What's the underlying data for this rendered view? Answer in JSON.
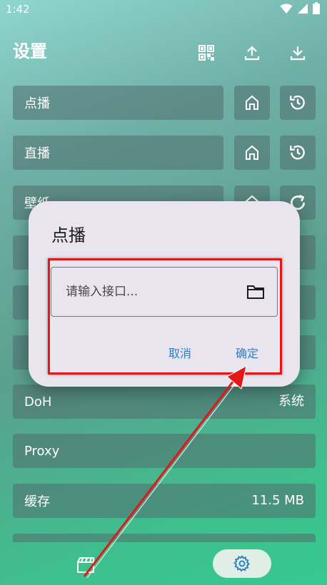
{
  "status_bar": {
    "time": "1:42"
  },
  "header": {
    "title": "设置"
  },
  "rows": [
    {
      "label": "点播"
    },
    {
      "label": "直播"
    },
    {
      "label": "壁纸"
    },
    {
      "label": ""
    },
    {
      "label": ""
    },
    {
      "label": ""
    },
    {
      "label": "DoH",
      "value": "系统"
    },
    {
      "label": "Proxy"
    },
    {
      "label": "缓存",
      "value": "11.5 MB"
    }
  ],
  "dialog": {
    "title": "点播",
    "input_placeholder": "请输入接口...",
    "input_value": "",
    "cancel_label": "取消",
    "confirm_label": "确定"
  },
  "icons": {
    "qr": "qr-code-icon",
    "upload": "upload-icon",
    "download": "download-icon",
    "home": "home-icon",
    "history": "history-icon",
    "refresh": "refresh-icon",
    "folder": "folder-icon",
    "film": "film-icon",
    "settings": "settings-gear-icon"
  },
  "colors": {
    "accent_blue": "#2f7fc2",
    "highlight_red": "#e01818",
    "dialog_bg": "#e9e5ee"
  }
}
